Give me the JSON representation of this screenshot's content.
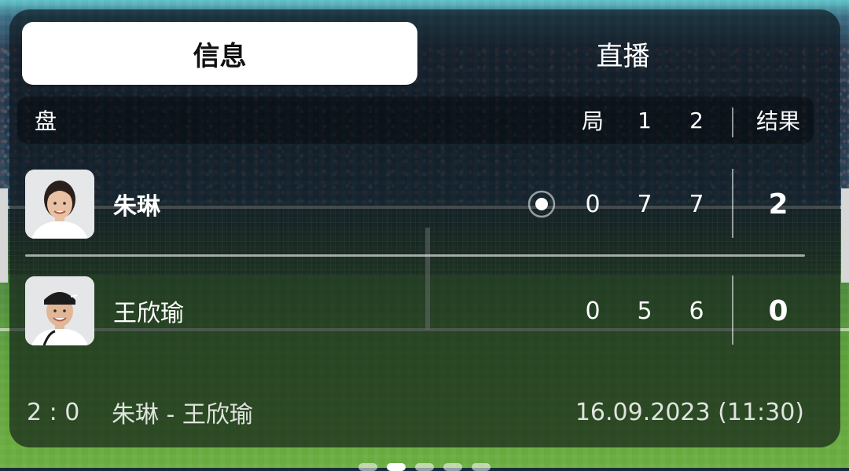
{
  "tabs": [
    {
      "label": "信息",
      "active": true
    },
    {
      "label": "直播",
      "active": false
    }
  ],
  "header": {
    "set_label": "盘",
    "game_col": "局",
    "set1_col": "1",
    "set2_col": "2",
    "result_col": "结果"
  },
  "players": [
    {
      "name": "朱琳",
      "serving": true,
      "game": "0",
      "set1": "7",
      "set2": "7",
      "result": "2",
      "avatar_icon": "player-photo-zhu-lin"
    },
    {
      "name": "王欣瑜",
      "serving": false,
      "game": "0",
      "set1": "5",
      "set2": "6",
      "result": "0",
      "avatar_icon": "player-photo-wang-xinyu"
    }
  ],
  "footer": {
    "score": "2 : 0",
    "match": "朱琳 - 王欣瑜",
    "datetime": "16.09.2023 (11:30)"
  },
  "pager": {
    "count": 5,
    "active_index": 1
  },
  "colors": {
    "card_bg": "#080e14",
    "tab_active_bg": "#ffffff",
    "court_green": "#5c9f3a",
    "sky_teal": "#5fc3c9"
  }
}
